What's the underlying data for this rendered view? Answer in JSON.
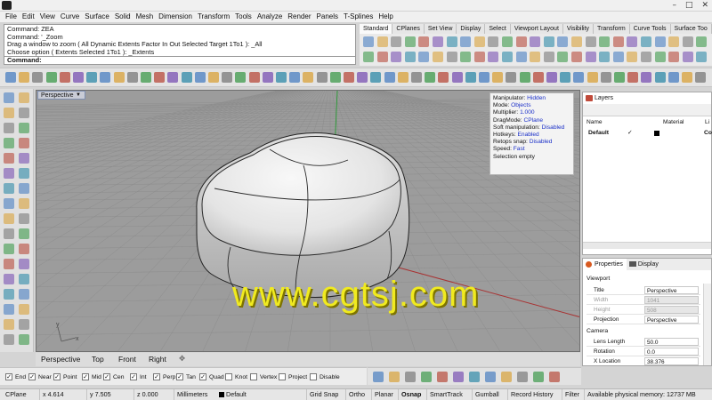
{
  "window": {
    "controls": {
      "minimize": "–",
      "maximize": "□",
      "close": "✕"
    }
  },
  "menu": [
    "File",
    "Edit",
    "View",
    "Curve",
    "Surface",
    "Solid",
    "Mesh",
    "Dimension",
    "Transform",
    "Tools",
    "Analyze",
    "Render",
    "Panels",
    "T-Splines",
    "Help"
  ],
  "command_history": [
    "Command: ZEA",
    "Command: '_Zoom",
    "Drag a window to zoom ( All  Dynamic  Extents  Factor  In  Out  Selected  Target  1To1 ): _All",
    "Choose option ( Extents  Selected  1To1 ): _Extents"
  ],
  "command_prompt": "Command:",
  "toolbar_tabs": [
    "Standard",
    "CPlanes",
    "Set View",
    "Display",
    "Select",
    "Viewport Layout",
    "Visibility",
    "Transform",
    "Curve Tools",
    "Surface Too"
  ],
  "toolbar_active_tab": 0,
  "viewport": {
    "label": "Perspective",
    "dropdown_glyph": "▼",
    "watermark": "www.cgtsj.com",
    "axis_labels": {
      "x": "x",
      "y": "y"
    }
  },
  "gumball_info": [
    {
      "label": "Manipulator:",
      "value": "Hidden"
    },
    {
      "label": "Mode:",
      "value": "Objects"
    },
    {
      "label": "Multiplier:",
      "value": "1.000"
    },
    {
      "label": "DragMode:",
      "value": "CPlane"
    },
    {
      "label": "Soft manipulation:",
      "value": "Disabled"
    },
    {
      "label": "Hotkeys:",
      "value": "Enabled"
    },
    {
      "label": "Retops snap:",
      "value": "Disabled"
    },
    {
      "label": "Speed:",
      "value": "Fast"
    },
    {
      "label": "Selection empty",
      "value": ""
    }
  ],
  "layers": {
    "tab": "Layers",
    "columns": {
      "name": "Name",
      "material": "Material",
      "extra": "Li"
    },
    "row": {
      "name": "Default",
      "check": "✓",
      "extra": "Co"
    }
  },
  "properties": {
    "tabs": [
      "Properties",
      "Display"
    ],
    "section_viewport": "Viewport",
    "section_camera": "Camera",
    "rows": [
      {
        "label": "Title",
        "value": "Perspective",
        "dim": false
      },
      {
        "label": "Width",
        "value": "1041",
        "dim": true
      },
      {
        "label": "Height",
        "value": "508",
        "dim": true
      },
      {
        "label": "Projection",
        "value": "Perspective",
        "dim": false
      }
    ],
    "camera_rows": [
      {
        "label": "Lens Length",
        "value": "50.0"
      },
      {
        "label": "Rotation",
        "value": "0.0"
      },
      {
        "label": "X Location",
        "value": "38.376"
      }
    ]
  },
  "view_tabs": [
    "Perspective",
    "Top",
    "Front",
    "Right"
  ],
  "view_tabs_add": "✥",
  "osnaps": [
    {
      "label": "End",
      "checked": true
    },
    {
      "label": "Near",
      "checked": true
    },
    {
      "label": "Point",
      "checked": true
    },
    {
      "label": "Mid",
      "checked": true
    },
    {
      "label": "Cen",
      "checked": true
    },
    {
      "label": "Int",
      "checked": true
    },
    {
      "label": "Perp",
      "checked": true
    },
    {
      "label": "Tan",
      "checked": true
    },
    {
      "label": "Quad",
      "checked": true
    },
    {
      "label": "Knot",
      "checked": false
    },
    {
      "label": "Vertex",
      "checked": false
    },
    {
      "label": "Project",
      "checked": false
    },
    {
      "label": "Disable",
      "checked": false
    }
  ],
  "status": {
    "cplane": "CPlane",
    "x": "x 4.614",
    "y": "y 7.505",
    "z": "z 0.000",
    "units": "Millimeters",
    "layer": "Default",
    "toggles": [
      "Grid Snap",
      "Ortho",
      "Planar",
      "Osnap",
      "SmartTrack",
      "Gumball",
      "Record History",
      "Filter"
    ],
    "bold_toggle": "Osnap",
    "memory": "Available physical memory: 12737 MB"
  },
  "colors": {
    "viewport_bg": "#9c9c9c",
    "grid": "#8c8c8c",
    "x_axis": "#a83232",
    "y_axis": "#2f9a3a",
    "watermark": "#f0ea20",
    "info_value": "#1a2fc8"
  }
}
